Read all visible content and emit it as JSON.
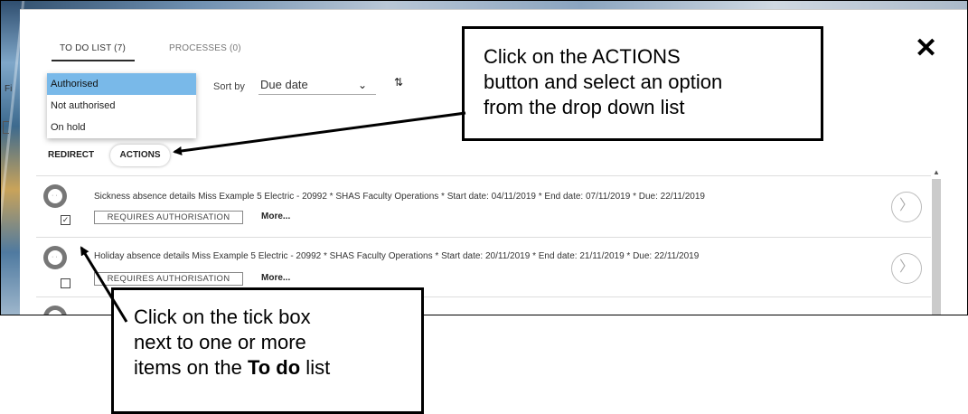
{
  "tabs": [
    {
      "label": "TO DO LIST (7)"
    },
    {
      "label": "PROCESSES (0)"
    }
  ],
  "filter_label_fragment": "Fi",
  "sort": {
    "label": "Sort by",
    "value": "Due date"
  },
  "dropdown": {
    "options": [
      "Authorised",
      "Not authorised",
      "On hold"
    ],
    "selected": "Authorised"
  },
  "toolbar": {
    "redirect_label": "REDIRECT",
    "actions_label": "ACTIONS"
  },
  "items": [
    {
      "text": "Sickness absence details Miss Example 5 Electric - 20992 * SHAS Faculty Operations * Start date: 04/11/2019 * End date: 07/11/2019 * Due: 22/11/2019",
      "badge": "REQUIRES AUTHORISATION",
      "more": "More...",
      "checked": true
    },
    {
      "text": "Holiday absence details Miss Example 5 Electric - 20992 * SHAS Faculty Operations * Start date: 20/11/2019 * End date: 21/11/2019 * Due: 22/11/2019",
      "badge": "REQUIRES AUTHORISATION",
      "more": "More...",
      "checked": false
    }
  ],
  "icons": {
    "close": "close-icon",
    "sort_direction": "sort-direction-icon",
    "dropdown": "chevron-down-icon",
    "avatar": "avatar-icon",
    "row_open": "chevron-right-icon",
    "scroll_up": "scroll-up-icon"
  },
  "callouts": {
    "actions_lines": [
      "Click on the ACTIONS",
      "button and select an option",
      "from the drop down list"
    ],
    "tick_lines": [
      "Click on the tick box",
      "next to one or more"
    ],
    "tick_last_prefix": "items on the ",
    "tick_last_bold": "To do",
    "tick_last_suffix": " list"
  },
  "colors": {
    "selected_option": "#79b9e9",
    "scrollbar": "#cbcbcb"
  }
}
